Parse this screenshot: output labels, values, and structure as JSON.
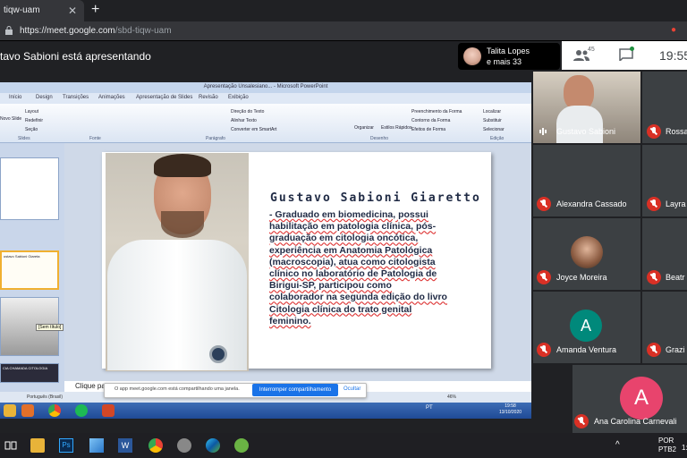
{
  "browser": {
    "tab_title": "tiqw-uam",
    "tab_close": "✕",
    "new_tab": "+",
    "url_host": "https://meet.google.com",
    "url_path": "/sbd-tiqw-uam"
  },
  "meet": {
    "presenting_text": "tavo Sabioni está apresentando",
    "participants_summary_name": "Talita Lopes",
    "participants_summary_more": "e mais 33",
    "people_count": "45",
    "time": "19:55",
    "colors": {
      "muted": "#d93025",
      "accent": "#1a73e8",
      "amanda": "#00897b",
      "ana": "#e8446d"
    }
  },
  "powerpoint": {
    "window_title": "Apresentação Unsalesiano... - Microsoft PowerPoint",
    "tabs": [
      "Início",
      "Design",
      "Transições",
      "Animações",
      "Apresentação de Slides",
      "Revisão",
      "Exibição"
    ],
    "groups": [
      "Slides",
      "Fonte",
      "Parágrafo",
      "Desenho",
      "Edição"
    ],
    "ribbon_items": [
      "Layout",
      "Redefinir",
      "Seção",
      "Novo Slide",
      "Direção do Texto",
      "Alinhar Texto",
      "Converter em SmartArt",
      "Organizar",
      "Estilos Rápidos",
      "Preenchimento da Forma",
      "Contorno da Forma",
      "Efeitos de Forma",
      "Localizar",
      "Substituir",
      "Selecionar"
    ],
    "slide_name": "Gustavo Sabioni Giaretto",
    "slide_bio": "- Graduado em biomedicina, possui habilitação em patologia clínica, pós-graduação em citologia oncótica, experiência em Anatomia Patológica (macroscopia), atua como citologista clínico no laboratório de Patologia de Birigui-SP, participou como colaborador na segunda edição do livro Citologia clínica do trato genital feminino.",
    "thumb_title": "ustavo Sabioni Giareta",
    "thumb_tooltip": "[Sem título]",
    "thumb_caption": "CIA CHAMADA CITOLOGIA",
    "notes_text": "Clique pa",
    "status_lang": "Português (Brasil)",
    "zoom": "46%",
    "taskbar_lang": "PT",
    "taskbar_time": "19:58",
    "taskbar_date": "13/10/2020"
  },
  "share_bar": {
    "message": "O app meet.google.com está compartilhando uma janela.",
    "stop_label": "Interromper compartilhamento",
    "hide_label": "Ocultar"
  },
  "participants": [
    {
      "name": "Gustavo Sabioni",
      "muted": false
    },
    {
      "name": "Rossa",
      "muted": true
    },
    {
      "name": "Alexandra Cassado",
      "muted": true
    },
    {
      "name": "Layra",
      "muted": true
    },
    {
      "name": "Joyce Moreira",
      "muted": true
    },
    {
      "name": "Beatr",
      "muted": true
    },
    {
      "name": "Amanda Ventura",
      "muted": true,
      "initial": "A"
    },
    {
      "name": "Grazi",
      "muted": true
    },
    {
      "name": "Ana Carolina Carnevali",
      "muted": true,
      "initial": "A"
    }
  ],
  "windows": {
    "lang_top": "POR",
    "lang_bottom": "PTB2",
    "time_short": "1:"
  }
}
